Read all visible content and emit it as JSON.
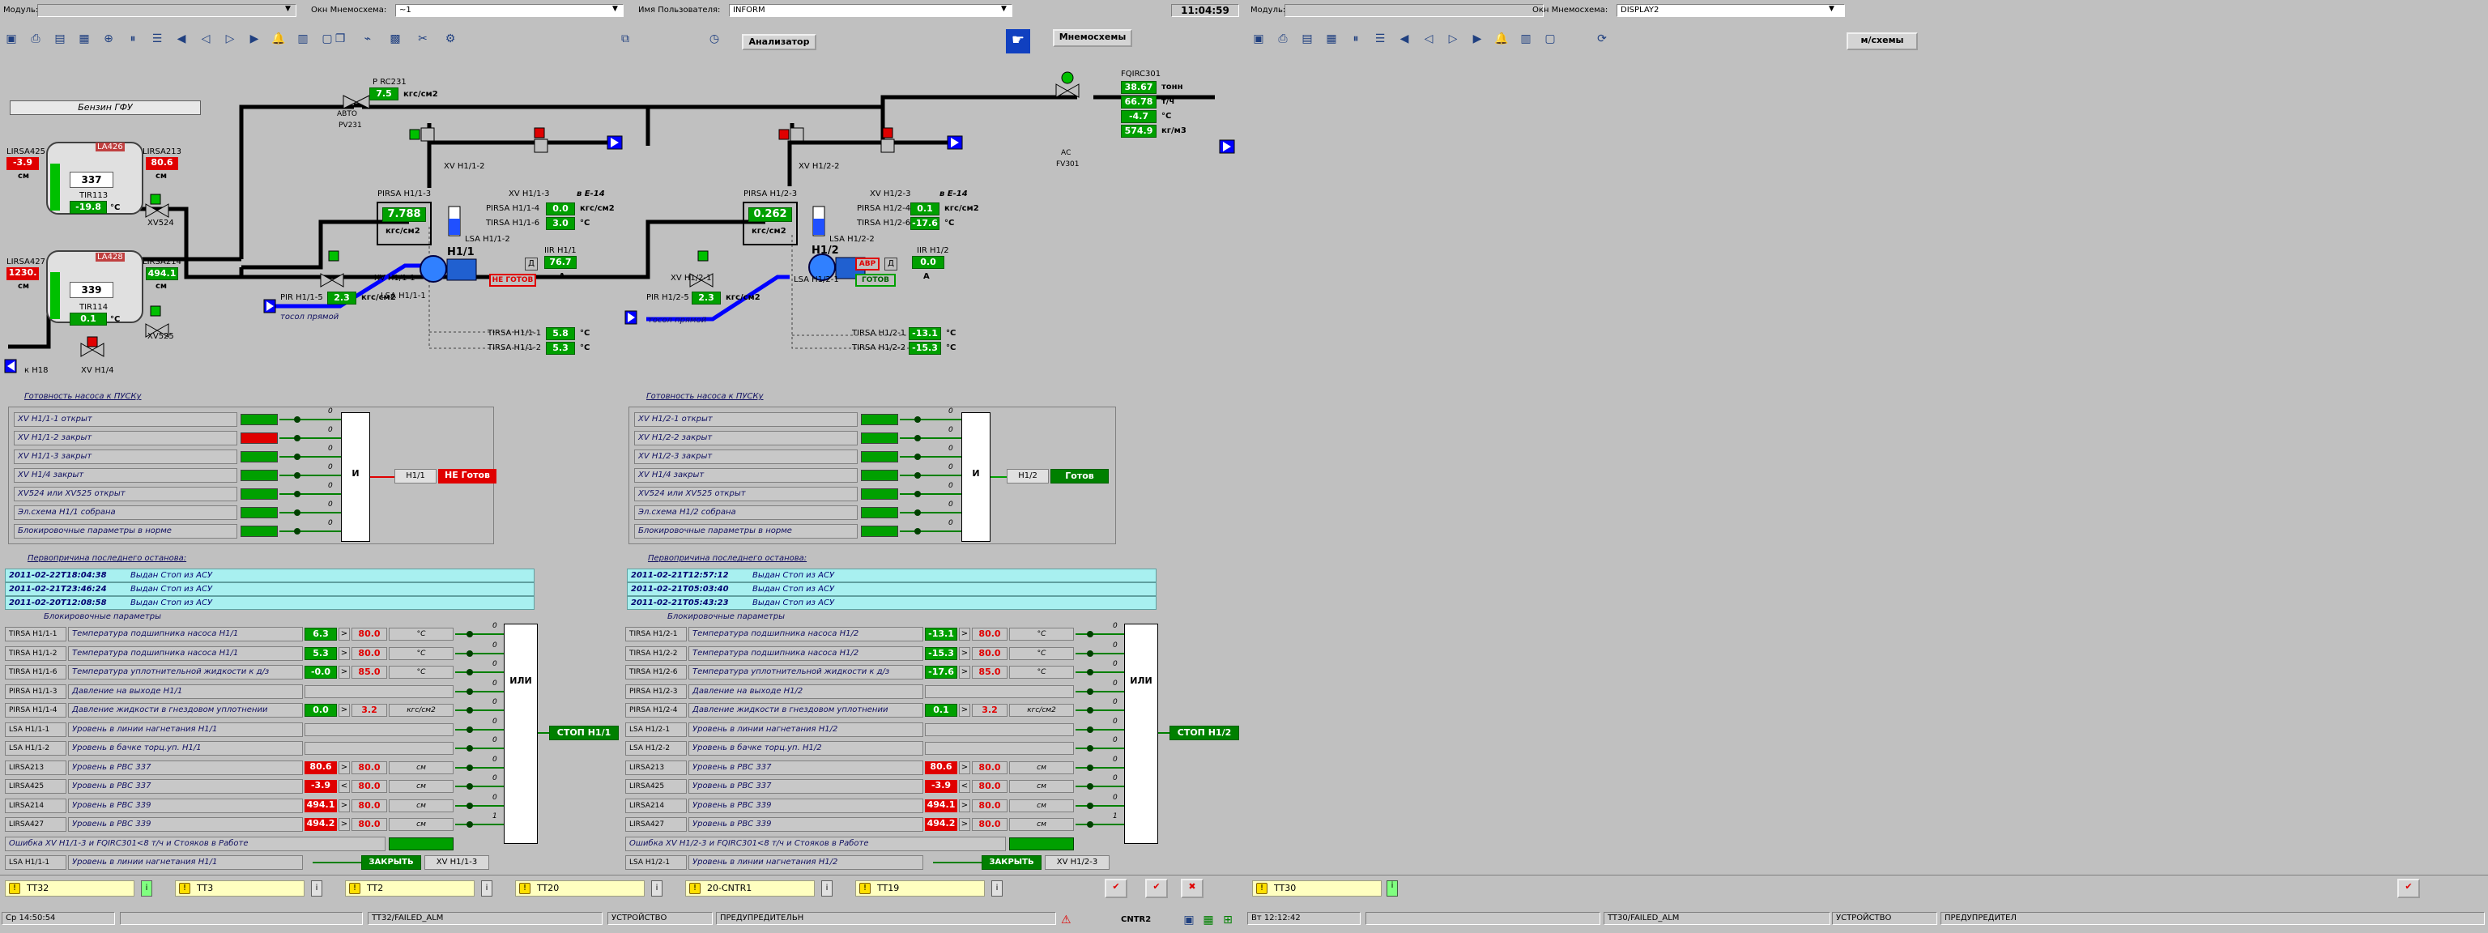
{
  "left_header": {
    "module_label": "Модуль:",
    "mnemo_label": "Окн Мнемосхема:",
    "mnemo_value": "~1",
    "user_label": "Имя Пользователя:",
    "user_value": "INFORM",
    "time": "11:04:59"
  },
  "right_header": {
    "module_label": "Модуль:",
    "mnemo_label": "Окн Мнемосхема:",
    "mnemo_value": "DISPLAY2"
  },
  "buttons": {
    "analyzer": "Анализатор",
    "mnemoschemes": "Мнемосхемы",
    "mnemo_short": "м/схемы"
  },
  "colors": {
    "green": "#00a000",
    "red": "#e00000",
    "cyan": "#a8f0f0",
    "pipe_blue": "#0000ff"
  },
  "diagram": {
    "benzin": "Бензин ГФУ",
    "tank1": {
      "lirsa_tag": "LIRSA425",
      "lirsa_val": "-3.9",
      "lirsa_unit": "см",
      "tag2": "LIRSA213",
      "val2": "80.6",
      "unit2": "см",
      "inner": "337",
      "lvl_tag": "LA426",
      "ti_tag": "TIR113",
      "ti_val": "-19.8",
      "ti_unit": "°C"
    },
    "tank2": {
      "lirsa_tag": "LIRSA427",
      "lirsa_val": "1230.",
      "lirsa_unit": "см",
      "tag2": "LIRSA214",
      "val2": "494.1",
      "unit2": "см",
      "inner": "339",
      "lvl_tag": "LA428",
      "ti_tag": "TIR114",
      "ti_val": "0.1",
      "ti_unit": "°C"
    },
    "xv524": "XV524",
    "xv525": "XV525",
    "xvh14": "XV H1/4",
    "to_h18": "к Н18",
    "prc231": {
      "tag": "P RC231",
      "val": "7.5",
      "unit": "кгс/см2",
      "valve": "PV231",
      "mode": "АВТО"
    },
    "fqirc301": {
      "tag": "FQIRC301",
      "v1": "38.67",
      "u1": "тонн",
      "v2": "66.78",
      "u2": "т/ч",
      "v3": "-4.7",
      "u3": "°C",
      "v4": "574.9",
      "u4": "кг/м3",
      "mode": "АС",
      "valve": "FV301"
    },
    "e14a": "в Е-14",
    "e14b": "в Е-14",
    "p1": {
      "name": "Н1/1",
      "pirsa_tag": "PIRSA H1/1-3",
      "pirsa_val": "7.788",
      "pirsa_unit": "кгс/см2",
      "xv1": "XV H1/1-2",
      "xv3": "XV H1/1-3",
      "xv_in": "XV H1/1-1",
      "lsa": "LSA H1/1-2",
      "lsa2": "LSA H1/1-1",
      "pirsa4": "PIRSA H1/1-4",
      "pirsa4_val": "0.0",
      "pirsa4_unit": "кгс/см2",
      "tirsa6": "TIRSA H1/1-6",
      "tirsa6_val": "3.0",
      "tirsa6_unit": "°C",
      "iir": "IIR H1/1",
      "iir_val": "76.7",
      "iir_unit": "А",
      "mode": "Д",
      "state": "НЕ ГОТОВ",
      "pir": "PIR H1/1-5",
      "pir_val": "2.3",
      "pir_unit": "кгс/см2",
      "antifreeze": "тосол прямой",
      "t1": "TIRSA H1/1-1",
      "t1_val": "5.8",
      "t1_unit": "°C",
      "t2": "TIRSA H1/1-2",
      "t2_val": "5.3",
      "t2_unit": "°C"
    },
    "p2": {
      "name": "Н1/2",
      "pirsa_tag": "PIRSA H1/2-3",
      "pirsa_val": "0.262",
      "pirsa_unit": "кгс/см2",
      "xv1": "XV H1/2-2",
      "xv3": "XV H1/2-3",
      "xv_in": "XV H1/2-1",
      "lsa": "LSA H1/2-2",
      "lsa2": "LSA H1/2-1",
      "pirsa4": "PIRSA H1/2-4",
      "pirsa4_val": "0.1",
      "pirsa4_unit": "кгс/см2",
      "tirsa6": "TIRSA H1/2-6",
      "tirsa6_val": "-17.6",
      "tirsa6_unit": "°C",
      "iir": "IIR H1/2",
      "iir_val": "0.0",
      "iir_unit": "А",
      "mode": "Д",
      "abr": "АВР",
      "state": "ГОТОВ",
      "pir": "PIR H1/2-5",
      "pir_val": "2.3",
      "pir_unit": "кгс/см2",
      "antifreeze": "тосол прямой",
      "t1": "TIRSA H1/2-1",
      "t1_val": "-13.1",
      "t1_unit": "°C",
      "t2": "TIRSA H1/2-2",
      "t2_val": "-15.3",
      "t2_unit": "°C"
    }
  },
  "ready1": {
    "title": "Готовность насоса к ПУСКу",
    "rows": [
      "XV H1/1-1 открыт",
      "XV H1/1-2 закрыт",
      "XV H1/1-3 закрыт",
      "XV H1/4 закрыт",
      "XV524 или XV525 открыт",
      "Эл.схема Н1/1 собрана",
      "Блокировочные параметры в норме"
    ],
    "and": "И",
    "pump": "Н1/1",
    "status": "НЕ Готов"
  },
  "ready2": {
    "title": "Готовность насоса к ПУСКу",
    "rows": [
      "XV H1/2-1 открыт",
      "XV H1/2-2 закрыт",
      "XV H1/2-3 закрыт",
      "XV H1/4 закрыт",
      "XV524 или XV525 открыт",
      "Эл.схема Н1/2 собрана",
      "Блокировочные параметры в норме"
    ],
    "and": "И",
    "pump": "Н1/2",
    "status": "Готов"
  },
  "stops1": {
    "title": "Первопричина последнего останова:",
    "rows": [
      [
        "2011-02-22T18:04:38",
        "Выдан Стоп из АСУ"
      ],
      [
        "2011-02-21T23:46:24",
        "Выдан Стоп из АСУ"
      ],
      [
        "2011-02-20T12:08:58",
        "Выдан Стоп из АСУ"
      ]
    ]
  },
  "stops2": {
    "title": "Первопричина последнего останова:",
    "rows": [
      [
        "2011-02-21T12:57:12",
        "Выдан Стоп из АСУ"
      ],
      [
        "2011-02-21T05:03:40",
        "Выдан Стоп из АСУ"
      ],
      [
        "2011-02-21T05:43:23",
        "Выдан Стоп из АСУ"
      ]
    ]
  },
  "block1": {
    "title": "Блокировочные параметры",
    "or": "ИЛИ",
    "stop": "СТОП Н1/1",
    "close": "ЗАКРЫТЬ",
    "close_tag": "XV H1/1-3",
    "rows": [
      {
        "tag": "TIRSA H1/1-1",
        "name": "Температура подшипника насоса Н1/1",
        "val": "6.3",
        "cmp": ">",
        "sp": "80.0",
        "unit": "°C"
      },
      {
        "tag": "TIRSA H1/1-2",
        "name": "Температура подшипника насоса Н1/1",
        "val": "5.3",
        "cmp": ">",
        "sp": "80.0",
        "unit": "°C"
      },
      {
        "tag": "TIRSA H1/1-6",
        "name": "Температура уплотнительной жидкости к д/з",
        "val": "-0.0",
        "cmp": ">",
        "sp": "85.0",
        "unit": "°C"
      },
      {
        "tag": "PIRSA H1/1-3",
        "name": "Давление на выходе Н1/1",
        "val": "",
        "cmp": "",
        "sp": "",
        "unit": ""
      },
      {
        "tag": "PIRSA H1/1-4",
        "name": "Давление жидкости в гнездовом уплотнении",
        "val": "0.0",
        "cmp": ">",
        "sp": "3.2",
        "unit": "кгс/см2"
      },
      {
        "tag": "LSA H1/1-1",
        "name": "Уровень в линии нагнетания Н1/1",
        "val": "",
        "cmp": "",
        "sp": "",
        "unit": ""
      },
      {
        "tag": "LSA H1/1-2",
        "name": "Уровень в бачке торц.уп. Н1/1",
        "val": "",
        "cmp": "",
        "sp": "",
        "unit": ""
      },
      {
        "tag": "LIRSA213",
        "name": "Уровень в РВС 337",
        "val": "80.6",
        "cmp": ">",
        "sp": "80.0",
        "unit": "см"
      },
      {
        "tag": "LIRSA425",
        "name": "Уровень в РВС 337",
        "val": "-3.9",
        "cmp": "<",
        "sp": "80.0",
        "unit": "см"
      },
      {
        "tag": "LIRSA214",
        "name": "Уровень в РВС 339",
        "val": "494.1",
        "cmp": ">",
        "sp": "80.0",
        "unit": "см"
      },
      {
        "tag": "LIRSA427",
        "name": "Уровень в РВС 339",
        "val": "494.2",
        "cmp": ">",
        "sp": "80.0",
        "unit": "см"
      }
    ],
    "err": "Ошибка XV H1/1-3 и FQIRC301<8 т/ч и Стояков в Работе",
    "last": "Уровень в линии нагнетания Н1/1",
    "last_tag": "LSA H1/1-1"
  },
  "block2": {
    "title": "Блокировочные параметры",
    "or": "ИЛИ",
    "stop": "СТОП Н1/2",
    "close": "ЗАКРЫТЬ",
    "close_tag": "XV H1/2-3",
    "rows": [
      {
        "tag": "TIRSA H1/2-1",
        "name": "Температура подшипника насоса Н1/2",
        "val": "-13.1",
        "cmp": ">",
        "sp": "80.0",
        "unit": "°C"
      },
      {
        "tag": "TIRSA H1/2-2",
        "name": "Температура подшипника насоса Н1/2",
        "val": "-15.3",
        "cmp": ">",
        "sp": "80.0",
        "unit": "°C"
      },
      {
        "tag": "TIRSA H1/2-6",
        "name": "Температура уплотнительной жидкости к д/з",
        "val": "-17.6",
        "cmp": ">",
        "sp": "85.0",
        "unit": "°C"
      },
      {
        "tag": "PIRSA H1/2-3",
        "name": "Давление на выходе Н1/2",
        "val": "",
        "cmp": "",
        "sp": "",
        "unit": ""
      },
      {
        "tag": "PIRSA H1/2-4",
        "name": "Давление жидкости в гнездовом уплотнении",
        "val": "0.1",
        "cmp": ">",
        "sp": "3.2",
        "unit": "кгс/см2"
      },
      {
        "tag": "LSA H1/2-1",
        "name": "Уровень в линии нагнетания Н1/2",
        "val": "",
        "cmp": "",
        "sp": "",
        "unit": ""
      },
      {
        "tag": "LSA H1/2-2",
        "name": "Уровень в бачке торц.уп. Н1/2",
        "val": "",
        "cmp": "",
        "sp": "",
        "unit": ""
      },
      {
        "tag": "LIRSA213",
        "name": "Уровень в РВС 337",
        "val": "80.6",
        "cmp": ">",
        "sp": "80.0",
        "unit": "см"
      },
      {
        "tag": "LIRSA425",
        "name": "Уровень в РВС 337",
        "val": "-3.9",
        "cmp": "<",
        "sp": "80.0",
        "unit": "см"
      },
      {
        "tag": "LIRSA214",
        "name": "Уровень в РВС 339",
        "val": "494.1",
        "cmp": ">",
        "sp": "80.0",
        "unit": "см"
      },
      {
        "tag": "LIRSA427",
        "name": "Уровень в РВС 339",
        "val": "494.2",
        "cmp": ">",
        "sp": "80.0",
        "unit": "см"
      }
    ],
    "err": "Ошибка XV H1/2-3 и FQIRC301<8 т/ч и Стояков в Работе",
    "last": "Уровень в линии нагнетания Н1/2",
    "last_tag": "LSA H1/2-1"
  },
  "alarms": [
    "TT32",
    "TT3",
    "TT2",
    "TT20",
    "20-CNTR1",
    "TT19"
  ],
  "alarm_right": "TT30",
  "status_left": {
    "date": "Ср 14:50:54",
    "tag": "TT32/FAILED_ALM",
    "dev": "УСТРОЙСТВО",
    "sev": "ПРЕДУПРЕДИТЕЛЬН",
    "cntr": "CNTR2"
  },
  "status_right": {
    "date": "Вт 12:12:42",
    "tag": "TT30/FAILED_ALM",
    "dev": "УСТРОЙСТВО",
    "sev": "ПРЕДУПРЕДИТЕЛ"
  }
}
